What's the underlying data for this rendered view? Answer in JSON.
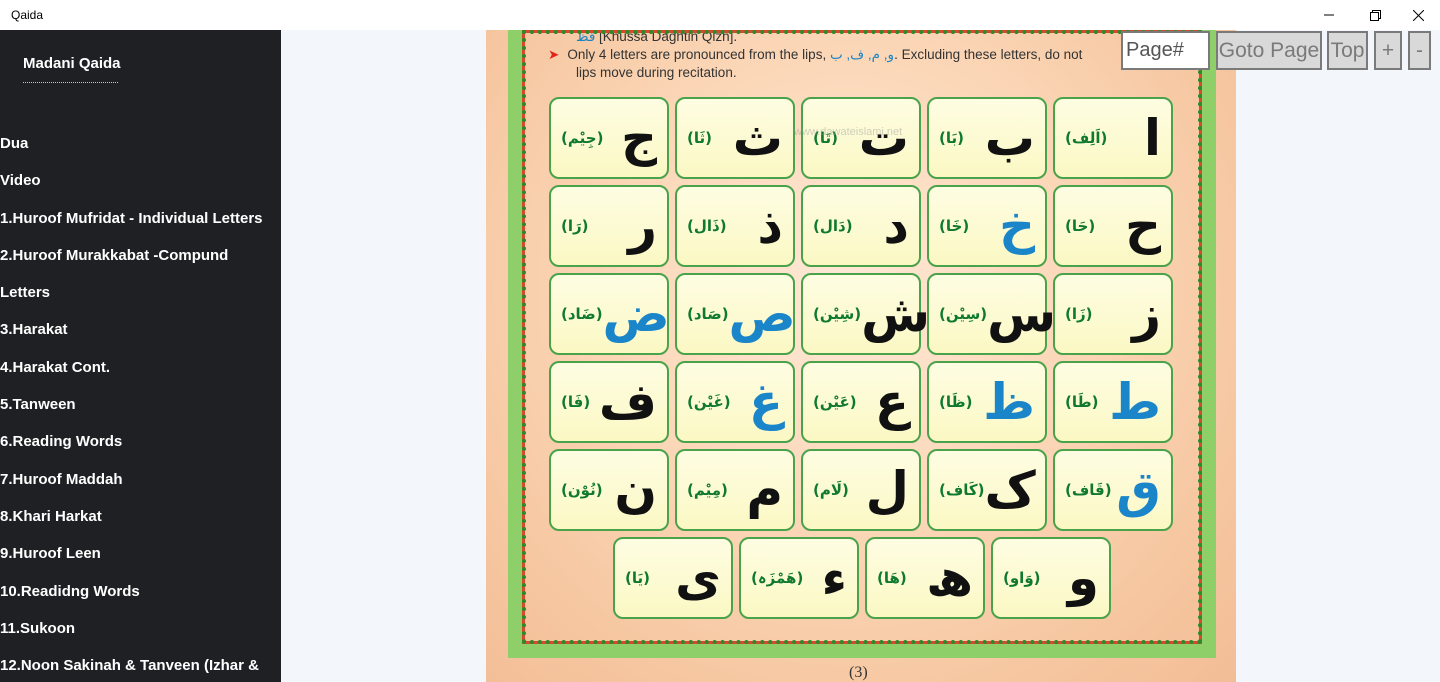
{
  "window": {
    "title": "Qaida",
    "buttons": [
      "minimize",
      "restore",
      "close"
    ]
  },
  "sidebar": {
    "brand": "Madani Qaida",
    "items": [
      {
        "label": "Dua"
      },
      {
        "label": "Video"
      },
      {
        "label": "1.Huroof Mufridat - Individual Letters"
      },
      {
        "label": "2.Huroof Murakkabat -Compund"
      },
      {
        "label": "Letters"
      },
      {
        "label": "3.Harakat"
      },
      {
        "label": "4.Harakat Cont."
      },
      {
        "label": "5.Tanween"
      },
      {
        "label": "6.Reading Words"
      },
      {
        "label": "7.Huroof Maddah"
      },
      {
        "label": "8.Khari Harkat"
      },
      {
        "label": "9.Huroof Leen"
      },
      {
        "label": "10.Readidng Words"
      },
      {
        "label": "11.Sukoon"
      },
      {
        "label": "12.Noon Sakinah & Tanveen (Izhar &"
      }
    ]
  },
  "toolbar": {
    "page_placeholder": "Page#",
    "goto_label": "Goto Page",
    "top_label": "Top",
    "zoom_in_label": "+",
    "zoom_out_label": "-"
  },
  "page": {
    "note_line1_ar": "قظ",
    "note_line1": "[Khussa Daghtin Qizh].",
    "note_line2": "Only 4 letters are pronounced from the lips,",
    "note_line2_ar": "و, م, ف, ب",
    "note_line2_rest": ". Excluding these letters, do not",
    "note_line3": "lips move during recitation.",
    "watermark": "www.dawateislami.net",
    "page_number": "(3)",
    "rows": [
      [
        {
          "letter": "ج",
          "name": "(جِیْم)",
          "color": "black"
        },
        {
          "letter": "ث",
          "name": "(ثَا)",
          "color": "black"
        },
        {
          "letter": "ت",
          "name": "(تَا)",
          "color": "black"
        },
        {
          "letter": "ب",
          "name": "(بَا)",
          "color": "black"
        },
        {
          "letter": "ا",
          "name": "(اَلِف)",
          "color": "black"
        }
      ],
      [
        {
          "letter": "ر",
          "name": "(رَا)",
          "color": "black"
        },
        {
          "letter": "ذ",
          "name": "(ذَال)",
          "color": "black"
        },
        {
          "letter": "د",
          "name": "(دَال)",
          "color": "black"
        },
        {
          "letter": "خ",
          "name": "(خَا)",
          "color": "blue"
        },
        {
          "letter": "ح",
          "name": "(حَا)",
          "color": "black"
        }
      ],
      [
        {
          "letter": "ض",
          "name": "(ضَاد)",
          "color": "blue"
        },
        {
          "letter": "ص",
          "name": "(صَاد)",
          "color": "blue"
        },
        {
          "letter": "ش",
          "name": "(شِیْن)",
          "color": "black"
        },
        {
          "letter": "س",
          "name": "(سِیْن)",
          "color": "black"
        },
        {
          "letter": "ز",
          "name": "(زَا)",
          "color": "black"
        }
      ],
      [
        {
          "letter": "ف",
          "name": "(فَا)",
          "color": "black"
        },
        {
          "letter": "غ",
          "name": "(غَیْن)",
          "color": "blue"
        },
        {
          "letter": "ع",
          "name": "(عَیْن)",
          "color": "black"
        },
        {
          "letter": "ظ",
          "name": "(ظَا)",
          "color": "blue"
        },
        {
          "letter": "ط",
          "name": "(طَا)",
          "color": "blue"
        }
      ],
      [
        {
          "letter": "ن",
          "name": "(نُوْن)",
          "color": "black"
        },
        {
          "letter": "م",
          "name": "(مِیْم)",
          "color": "black"
        },
        {
          "letter": "ل",
          "name": "(لَام)",
          "color": "black"
        },
        {
          "letter": "ک",
          "name": "(کَاف)",
          "color": "black"
        },
        {
          "letter": "ق",
          "name": "(قَاف)",
          "color": "blue"
        }
      ],
      [
        {
          "letter": "ی",
          "name": "(یَا)",
          "color": "black"
        },
        {
          "letter": "ء",
          "name": "(ھَمْزَہ)",
          "color": "black"
        },
        {
          "letter": "ھ",
          "name": "(ھَا)",
          "color": "black"
        },
        {
          "letter": "و",
          "name": "(وَاو)",
          "color": "black"
        }
      ]
    ]
  }
}
